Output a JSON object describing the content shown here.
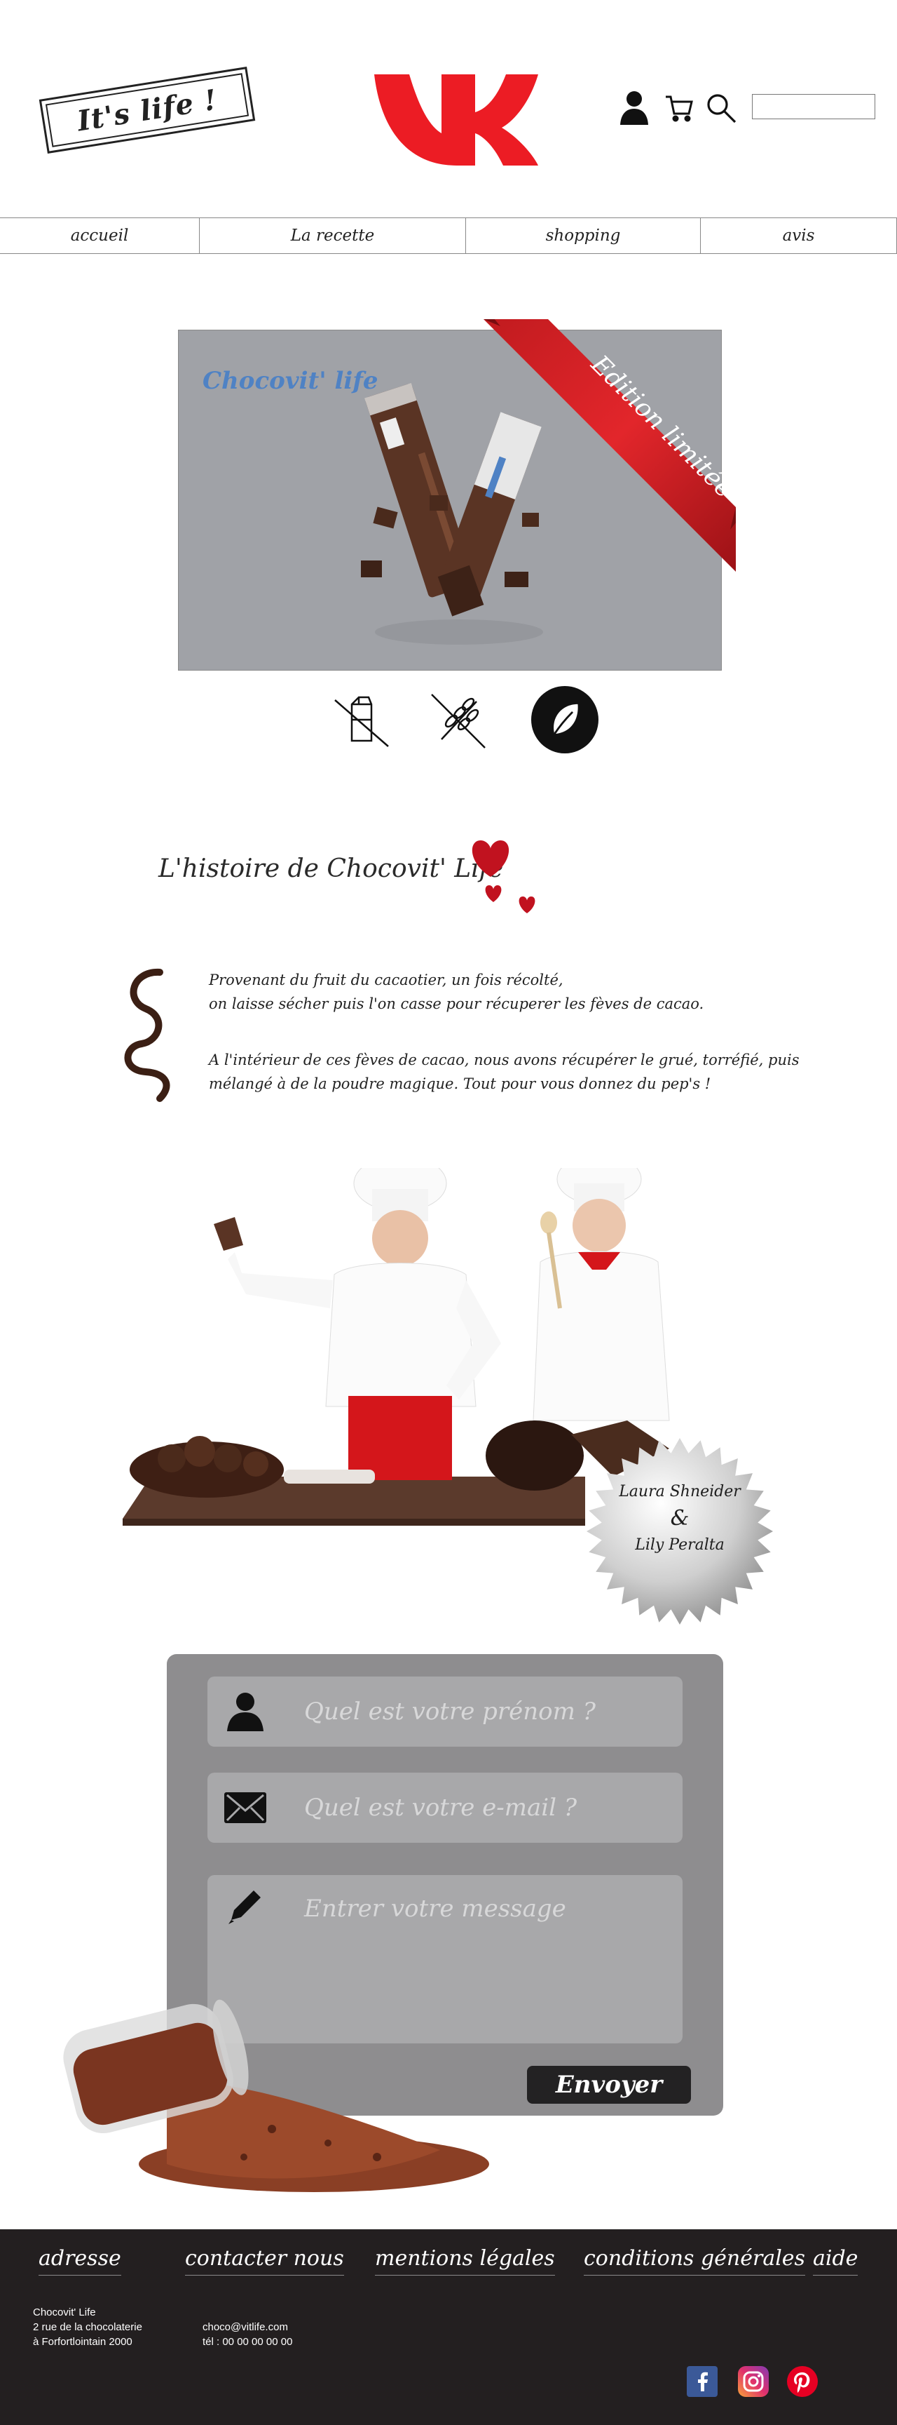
{
  "header": {
    "brand_stamp": "It's life !",
    "logo": "vk-logo",
    "icons": [
      "user-icon",
      "cart-icon",
      "search-icon"
    ],
    "search": {
      "value": "",
      "placeholder": ""
    }
  },
  "nav": [
    {
      "label": "accueil"
    },
    {
      "label": "La recette"
    },
    {
      "label": "shopping"
    },
    {
      "label": "avis"
    }
  ],
  "product": {
    "name": "Chocovit' life",
    "ribbon": "Edition limitée",
    "diet_icons": [
      "no-milk-icon",
      "no-gluten-icon",
      "vegan-leaf-icon"
    ]
  },
  "story": {
    "title": "L'histoire de Chocovit' Life",
    "p1_line1": "Provenant du fruit du cacaotier, un fois récolté,",
    "p1_line2": "on laisse sécher puis l'on casse pour récuperer les fèves de cacao.",
    "p2_line1": "A l'intérieur de ces fèves de cacao, nous avons récupérer le grué, torréfié, puis",
    "p2_line2": "mélangé à de la poudre magique. Tout pour vous donnez du pep's !"
  },
  "chefs": {
    "name1": "Laura Shneider",
    "amp": "&",
    "name2": "Lily Peralta"
  },
  "form": {
    "name_placeholder": "Quel est votre prénom ?",
    "email_placeholder": "Quel est votre e-mail ?",
    "message_placeholder": "Entrer votre message",
    "submit_label": "Envoyer"
  },
  "footer": {
    "links": [
      "adresse",
      "contacter nous",
      "mentions légales",
      "conditions générales",
      "aide"
    ],
    "address": [
      "Chocovit' Life",
      "2 rue de la chocolaterie",
      "à Forfortlointain 2000"
    ],
    "contact": [
      "choco@vitlife.com",
      "tél : 00 00 00 00 00"
    ],
    "social": [
      "facebook-icon",
      "instagram-icon",
      "pinterest-icon"
    ]
  },
  "colors": {
    "brand_red": "#ec1c24",
    "product_bg": "#a0a2a7",
    "form_bg": "#8e8d8f",
    "footer_bg": "#231f20",
    "product_name": "#4f82c4"
  }
}
